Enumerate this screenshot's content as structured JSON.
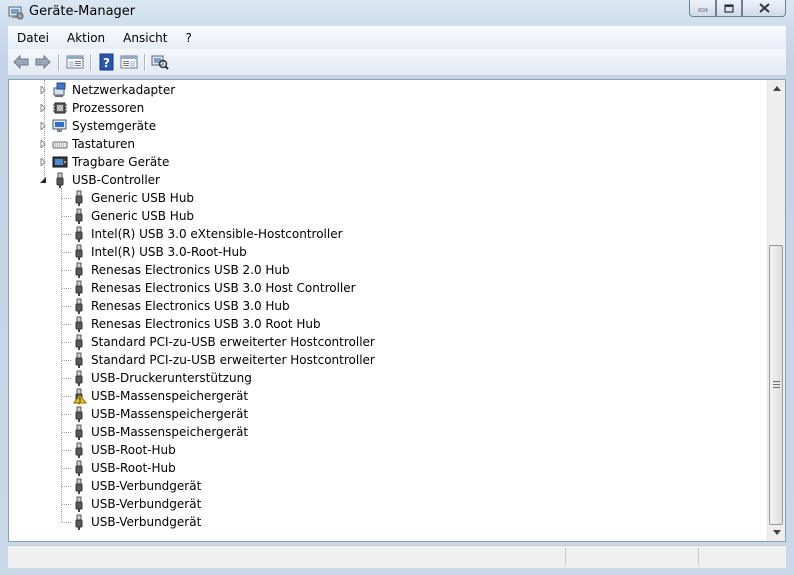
{
  "window": {
    "title": "Geräte-Manager"
  },
  "menu": [
    "Datei",
    "Aktion",
    "Ansicht",
    "?"
  ],
  "toolbar": {
    "icons": [
      "back-arrow-icon",
      "forward-arrow-icon",
      "show-hide-tree-icon",
      "help-icon",
      "properties-view-icon",
      "scan-hardware-icon"
    ]
  },
  "tree": {
    "categories": [
      {
        "label": "Netzwerkadapter",
        "icon": "network-adapter-icon",
        "expanded": false
      },
      {
        "label": "Prozessoren",
        "icon": "processor-icon",
        "expanded": false
      },
      {
        "label": "Systemgeräte",
        "icon": "system-devices-icon",
        "expanded": false
      },
      {
        "label": "Tastaturen",
        "icon": "keyboard-icon",
        "expanded": false
      },
      {
        "label": "Tragbare Geräte",
        "icon": "portable-device-icon",
        "expanded": false
      },
      {
        "label": "USB-Controller",
        "icon": "usb-plug-icon",
        "expanded": true
      }
    ],
    "usb_children": [
      {
        "label": "Generic USB Hub",
        "warning": false
      },
      {
        "label": "Generic USB Hub",
        "warning": false
      },
      {
        "label": "Intel(R) USB 3.0 eXtensible-Hostcontroller",
        "warning": false
      },
      {
        "label": "Intel(R) USB 3.0-Root-Hub",
        "warning": false
      },
      {
        "label": "Renesas Electronics USB 2.0 Hub",
        "warning": false
      },
      {
        "label": "Renesas Electronics USB 3.0 Host Controller",
        "warning": false
      },
      {
        "label": "Renesas Electronics USB 3.0 Hub",
        "warning": false
      },
      {
        "label": "Renesas Electronics USB 3.0 Root Hub",
        "warning": false
      },
      {
        "label": "Standard PCI-zu-USB erweiterter Hostcontroller",
        "warning": false
      },
      {
        "label": "Standard PCI-zu-USB erweiterter Hostcontroller",
        "warning": false
      },
      {
        "label": "USB-Druckerunterstützung",
        "warning": false
      },
      {
        "label": "USB-Massenspeichergerät",
        "warning": true
      },
      {
        "label": "USB-Massenspeichergerät",
        "warning": false
      },
      {
        "label": "USB-Massenspeichergerät",
        "warning": false
      },
      {
        "label": "USB-Root-Hub",
        "warning": false
      },
      {
        "label": "USB-Root-Hub",
        "warning": false
      },
      {
        "label": "USB-Verbundgerät",
        "warning": false
      },
      {
        "label": "USB-Verbundgerät",
        "warning": false
      },
      {
        "label": "USB-Verbundgerät",
        "warning": false
      }
    ]
  },
  "colors": {
    "accent": "#3a6ea5",
    "warning": "#f0c020",
    "usb_icon": "#505050"
  }
}
